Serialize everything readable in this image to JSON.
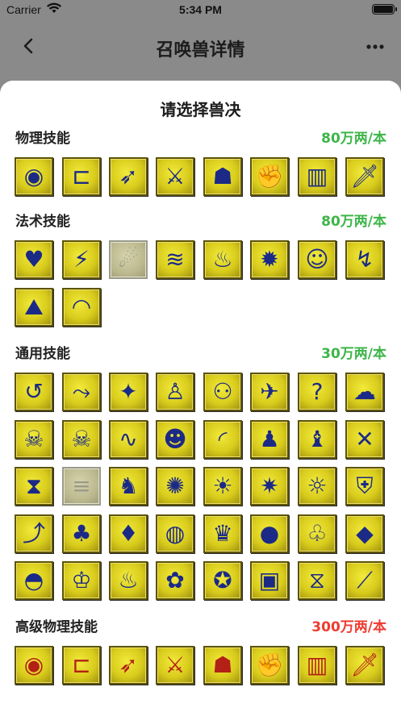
{
  "status": {
    "carrier": "Carrier",
    "time": "5:34 PM"
  },
  "nav": {
    "title": "召唤兽详情"
  },
  "sheet": {
    "title": "请选择兽决"
  },
  "colors": {
    "green": "#3db548",
    "red": "#ee3b30"
  },
  "sections": [
    {
      "name": "物理技能",
      "price": "80万两/本",
      "price_color": "#3db548",
      "tint": "blue",
      "icons": [
        {
          "name": "eye-icon",
          "glyph": "◉"
        },
        {
          "name": "fangs-icon",
          "glyph": "⊏"
        },
        {
          "name": "bow-icon",
          "glyph": "➶"
        },
        {
          "name": "sword-icon",
          "glyph": "⚔"
        },
        {
          "name": "figure-icon",
          "glyph": "☗"
        },
        {
          "name": "arm-icon",
          "glyph": "✊"
        },
        {
          "name": "cage-icon",
          "glyph": "▥"
        },
        {
          "name": "blade-icon",
          "glyph": "🗡"
        }
      ]
    },
    {
      "name": "法术技能",
      "price": "80万两/本",
      "price_color": "#3db548",
      "tint": "blue",
      "icons": [
        {
          "name": "heart-shield-icon",
          "glyph": "♥"
        },
        {
          "name": "lightning-icon",
          "glyph": "⚡"
        },
        {
          "name": "meteor-icon",
          "glyph": "☄",
          "disabled": true
        },
        {
          "name": "water-wave-icon",
          "glyph": "≋"
        },
        {
          "name": "fire-icon",
          "glyph": "♨"
        },
        {
          "name": "explosion-icon",
          "glyph": "✹"
        },
        {
          "name": "doll-icon",
          "glyph": "☺"
        },
        {
          "name": "storm-icon",
          "glyph": "↯"
        },
        {
          "name": "earthquake-icon",
          "glyph": "⛰"
        },
        {
          "name": "sound-wave-icon",
          "glyph": "◠"
        }
      ]
    },
    {
      "name": "通用技能",
      "price": "30万两/本",
      "price_color": "#3db548",
      "tint": "blue",
      "icons": [
        {
          "name": "return-arrow-icon",
          "glyph": "↺"
        },
        {
          "name": "dodge-icon",
          "glyph": "⤳"
        },
        {
          "name": "wings-icon",
          "glyph": "✦"
        },
        {
          "name": "person-icon",
          "glyph": "♙"
        },
        {
          "name": "owl-icon",
          "glyph": "⚇"
        },
        {
          "name": "bird-icon",
          "glyph": "✈"
        },
        {
          "name": "question-head-icon",
          "glyph": "?"
        },
        {
          "name": "cloud-icon",
          "glyph": "☁"
        },
        {
          "name": "skeleton-icon",
          "glyph": "☠"
        },
        {
          "name": "skull-icon",
          "glyph": "☠"
        },
        {
          "name": "snake-icon",
          "glyph": "∿"
        },
        {
          "name": "head-icon",
          "glyph": "☻"
        },
        {
          "name": "rainbow-icon",
          "glyph": "◜"
        },
        {
          "name": "suit-icon",
          "glyph": "♟"
        },
        {
          "name": "praying-icon",
          "glyph": "♝"
        },
        {
          "name": "crossed-swords-icon",
          "glyph": "✕"
        },
        {
          "name": "hourglass-icon",
          "glyph": "⧗"
        },
        {
          "name": "shoe-icon",
          "glyph": "≡",
          "disabled": true
        },
        {
          "name": "cloak-icon",
          "glyph": "♞"
        },
        {
          "name": "sun-spark-icon",
          "glyph": "✺"
        },
        {
          "name": "sun-ring-icon",
          "glyph": "☀"
        },
        {
          "name": "sun-core-icon",
          "glyph": "✷"
        },
        {
          "name": "sun-crown-icon",
          "glyph": "☼"
        },
        {
          "name": "shield-icon",
          "glyph": "⛨"
        },
        {
          "name": "tree-arrow-icon",
          "glyph": "⤴"
        },
        {
          "name": "tree-icon",
          "glyph": "♣"
        },
        {
          "name": "blue-flame-icon",
          "glyph": "♦"
        },
        {
          "name": "wind-orb-icon",
          "glyph": "◍"
        },
        {
          "name": "crown-orb-icon",
          "glyph": "♛"
        },
        {
          "name": "fire-orb-icon",
          "glyph": "●"
        },
        {
          "name": "sprout-orb-icon",
          "glyph": "♧"
        },
        {
          "name": "flame-orb-icon",
          "glyph": "◆"
        },
        {
          "name": "blue-wave-blob-icon",
          "glyph": "◓"
        },
        {
          "name": "crown-blob-icon",
          "glyph": "♔"
        },
        {
          "name": "fire-blob-icon",
          "glyph": "♨"
        },
        {
          "name": "sprout-blob-icon",
          "glyph": "✿"
        },
        {
          "name": "turtle-shell-icon",
          "glyph": "✪"
        },
        {
          "name": "circuit-icon",
          "glyph": "▣"
        },
        {
          "name": "hourglass-frame-icon",
          "glyph": "⧖"
        },
        {
          "name": "spear-icon",
          "glyph": "⟋"
        }
      ]
    },
    {
      "name": "高级物理技能",
      "price": "300万两/本",
      "price_color": "#ee3b30",
      "tint": "red",
      "icons": [
        {
          "name": "adv-eye-icon",
          "glyph": "◉"
        },
        {
          "name": "adv-fangs-icon",
          "glyph": "⊏"
        },
        {
          "name": "adv-bow-icon",
          "glyph": "➶"
        },
        {
          "name": "adv-sword-icon",
          "glyph": "⚔"
        },
        {
          "name": "adv-figure-icon",
          "glyph": "☗"
        },
        {
          "name": "adv-arm-icon",
          "glyph": "✊"
        },
        {
          "name": "adv-cage-icon",
          "glyph": "▥"
        },
        {
          "name": "adv-blade-icon",
          "glyph": "🗡"
        }
      ]
    }
  ]
}
